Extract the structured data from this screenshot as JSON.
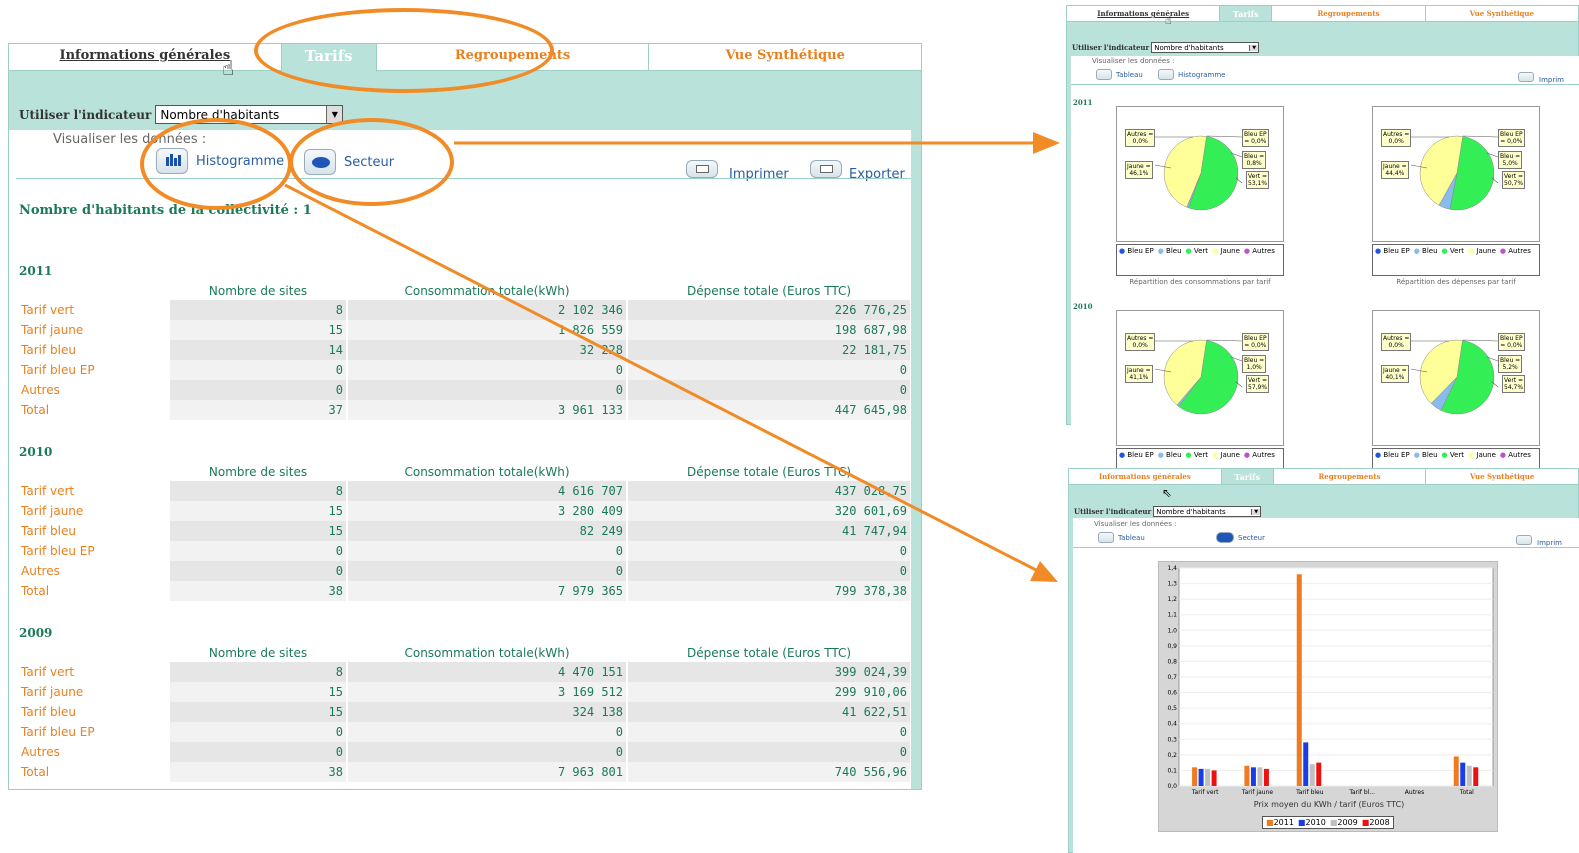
{
  "tabs": [
    "Informations générales",
    "Tarifs",
    "Regroupements",
    "Vue Synthétique"
  ],
  "indicator": {
    "label": "Utiliser l'indicateur",
    "value": "Nombre d'habitants"
  },
  "visualize": {
    "label": "Visualiser les données :",
    "histogram": "Histogramme",
    "sector": "Secteur",
    "table": "Tableau"
  },
  "actions": {
    "print": "Imprimer",
    "export": "Exporter",
    "print_short": "Imprim"
  },
  "main_title": "Nombre d'habitants de la collectivité : 1",
  "columns": [
    "Nombre de sites",
    "Consommation totale(kWh)",
    "Dépense totale (Euros TTC)"
  ],
  "years": [
    {
      "year": "2011",
      "rows": [
        [
          "Tarif vert",
          "8",
          "2 102 346",
          "226 776,25"
        ],
        [
          "Tarif jaune",
          "15",
          "1 826 559",
          "198 687,98"
        ],
        [
          "Tarif bleu",
          "14",
          "32 228",
          "22 181,75"
        ],
        [
          "Tarif bleu EP",
          "0",
          "0",
          "0"
        ],
        [
          "Autres",
          "0",
          "0",
          "0"
        ],
        [
          "Total",
          "37",
          "3 961 133",
          "447 645,98"
        ]
      ]
    },
    {
      "year": "2010",
      "rows": [
        [
          "Tarif vert",
          "8",
          "4 616 707",
          "437 028,75"
        ],
        [
          "Tarif jaune",
          "15",
          "3 280 409",
          "320 601,69"
        ],
        [
          "Tarif bleu",
          "15",
          "82 249",
          "41 747,94"
        ],
        [
          "Tarif bleu EP",
          "0",
          "0",
          "0"
        ],
        [
          "Autres",
          "0",
          "0",
          "0"
        ],
        [
          "Total",
          "38",
          "7 979 365",
          "799 378,38"
        ]
      ]
    },
    {
      "year": "2009",
      "rows": [
        [
          "Tarif vert",
          "8",
          "4 470 151",
          "399 024,39"
        ],
        [
          "Tarif jaune",
          "15",
          "3 169 512",
          "299 910,06"
        ],
        [
          "Tarif bleu",
          "15",
          "324 138",
          "41 622,51"
        ],
        [
          "Tarif bleu EP",
          "0",
          "0",
          "0"
        ],
        [
          "Autres",
          "0",
          "0",
          "0"
        ],
        [
          "Total",
          "38",
          "7 963 801",
          "740 556,96"
        ]
      ]
    }
  ],
  "pies": {
    "caption_cons": "Répartition des consommations par tarif",
    "caption_dep": "Répartition des dépenses par tarif",
    "legend": [
      "Bleu EP",
      "Bleu",
      "Vert",
      "Jaune",
      "Autres"
    ],
    "legend_colors": [
      "#2255dd",
      "#88bbee",
      "#33ee55",
      "#ffff99",
      "#bb55cc"
    ],
    "blocks": [
      {
        "year": "2011",
        "charts": [
          {
            "autres": "Autres =\n0,0%",
            "jaune": "Jaune =\n46,1%",
            "bleuep": "Bleu EP\n= 0,0%",
            "bleu": "Bleu =\n0,8%",
            "vert": "Vert =\n53,1%",
            "values": {
              "Vert": 53.1,
              "Bleu": 0.8,
              "Bleu EP": 0,
              "Autres": 0,
              "Jaune": 46.1
            }
          },
          {
            "autres": "Autres =\n0,0%",
            "jaune": "Jaune =\n44,4%",
            "bleuep": "Bleu EP\n= 0,0%",
            "bleu": "Bleu =\n5,0%",
            "vert": "Vert =\n50,7%",
            "values": {
              "Vert": 50.7,
              "Bleu": 5.0,
              "Bleu EP": 0,
              "Autres": 0,
              "Jaune": 44.4
            }
          }
        ]
      },
      {
        "year": "2010",
        "charts": [
          {
            "autres": "Autres =\n0,0%",
            "jaune": "Jaune =\n41,1%",
            "bleuep": "Bleu EP\n= 0,0%",
            "bleu": "Bleu =\n1,0%",
            "vert": "Vert =\n57,9%",
            "values": {
              "Vert": 57.9,
              "Bleu": 1.0,
              "Bleu EP": 0,
              "Autres": 0,
              "Jaune": 41.1
            }
          },
          {
            "autres": "Autres =\n0,0%",
            "jaune": "Jaune =\n40,1%",
            "bleuep": "Bleu EP\n= 0,0%",
            "bleu": "Bleu =\n5,2%",
            "vert": "Vert =\n54,7%",
            "values": {
              "Vert": 54.7,
              "Bleu": 5.2,
              "Bleu EP": 0,
              "Autres": 0,
              "Jaune": 40.1
            }
          }
        ]
      }
    ]
  },
  "chart_data": {
    "type": "bar",
    "categories": [
      "Tarif vert",
      "Tarif jaune",
      "Tarif bleu",
      "Tarif bl...",
      "Autres",
      "Total"
    ],
    "series": [
      {
        "name": "2011",
        "color": "#f07a20",
        "values": [
          0.12,
          0.13,
          1.36,
          0,
          0,
          0.19
        ]
      },
      {
        "name": "2010",
        "color": "#1b3de8",
        "values": [
          0.11,
          0.12,
          0.28,
          0,
          0,
          0.15
        ]
      },
      {
        "name": "2009",
        "color": "#c0c0c0",
        "values": [
          0.11,
          0.12,
          0.14,
          0,
          0,
          0.13
        ]
      },
      {
        "name": "2008",
        "color": "#ee1111",
        "values": [
          0.1,
          0.11,
          0.15,
          0,
          0,
          0.12
        ]
      }
    ],
    "xlabel": "Prix moyen du KWh / tarif (Euros TTC)",
    "ylim": [
      0,
      1.4
    ],
    "yticks": [
      "0,0",
      "0,1",
      "0,2",
      "0,3",
      "0,4",
      "0,5",
      "0,6",
      "0,7",
      "0,8",
      "0,9",
      "1,0",
      "1,1",
      "1,2",
      "1,3",
      "1,4"
    ],
    "legend_position": "bottom"
  }
}
